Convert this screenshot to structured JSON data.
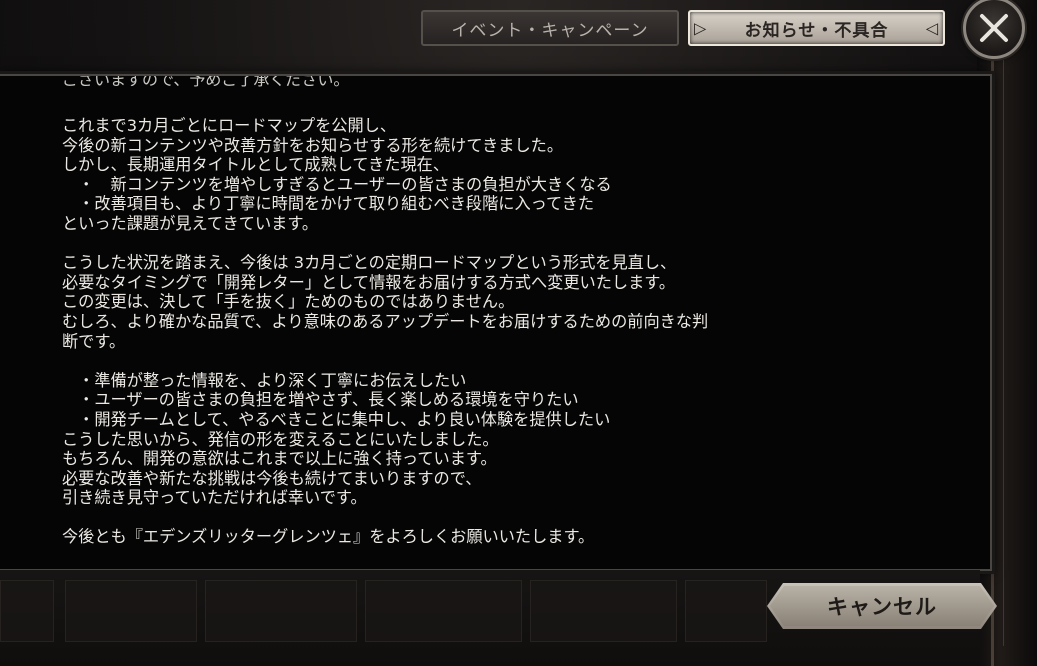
{
  "tabs": {
    "events_label": "イベント・キャンペーン",
    "news_label": "お知らせ・不具合"
  },
  "notice": {
    "clipped_top_line": "ございますので、予めご了承ください。",
    "paragraphs": [
      [
        "これまで3カ月ごとにロードマップを公開し、",
        "今後の新コンテンツや改善方針をお知らせする形を続けてきました。",
        "しかし、長期運用タイトルとして成熟してきた現在、",
        "　・　新コンテンツを増やしすぎるとユーザーの皆さまの負担が大きくなる",
        "　・改善項目も、より丁寧に時間をかけて取り組むべき段階に入ってきた",
        "といった課題が見えてきています。"
      ],
      [
        "こうした状況を踏まえ、今後は 3カ月ごとの定期ロードマップという形式を見直し、",
        "必要なタイミングで「開発レター」として情報をお届けする方式へ変更いたします。",
        "この変更は、決して「手を抜く」ためのものではありません。",
        "むしろ、より確かな品質で、より意味のあるアップデートをお届けするための前向きな判",
        "断です。"
      ],
      [
        "　・準備が整った情報を、より深く丁寧にお伝えしたい",
        "　・ユーザーの皆さまの負担を増やさず、長く楽しめる環境を守りたい",
        "　・開発チームとして、やるべきことに集中し、より良い体験を提供したい",
        "こうした思いから、発信の形を変えることにいたしました。",
        "もちろん、開発の意欲はこれまで以上に強く持っています。",
        "必要な改善や新たな挑戦は今後も続けてまいりますので、",
        "引き続き見守っていただければ幸いです。"
      ],
      [
        "今後とも『エデンズリッターグレンツェ』をよろしくお願いいたします。"
      ]
    ]
  },
  "buttons": {
    "cancel_label": "キャンセル"
  },
  "icons": {
    "close": "close-icon",
    "tab_left": "chevron-right-icon",
    "tab_right": "chevron-left-icon"
  },
  "colors": {
    "panel_bg": "#050505",
    "text": "#ece9e4",
    "active_tab": "#d8d2c9",
    "inactive_tab": "#3b3634"
  }
}
